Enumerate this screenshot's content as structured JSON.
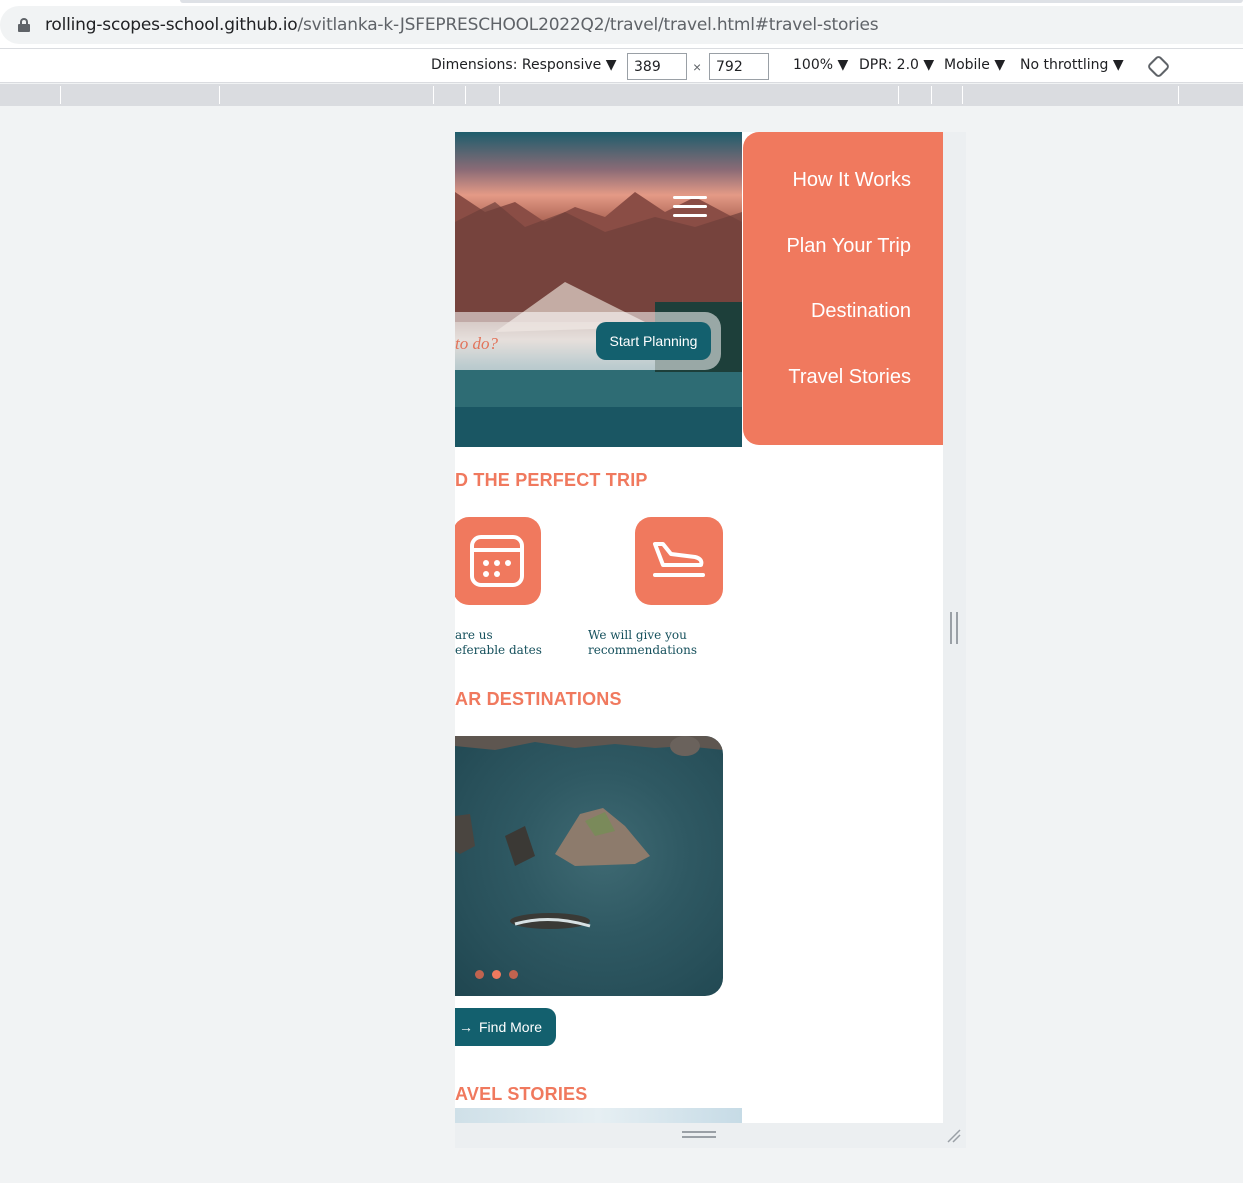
{
  "browser": {
    "url_host": "rolling-scopes-school.github.io",
    "url_path": "/svitlanka-k-JSFEPRESCHOOL2022Q2/travel/travel.html#travel-stories"
  },
  "devtools": {
    "dimensions_label": "Dimensions: Responsive ▼",
    "width_value": "389",
    "height_value": "792",
    "times": "×",
    "zoom_label": "100% ▼",
    "dpr_label": "DPR: 2.0 ▼",
    "device_label": "Mobile ▼",
    "throttling_label": "No throttling ▼",
    "rotate_icon": "rotate-icon"
  },
  "page": {
    "search_placeholder": "to do?",
    "start_button": "Start Planning",
    "menu": [
      "How It Works",
      "Plan Your Trip",
      "Destination",
      "Travel Stories"
    ],
    "section_trip": "D THE PERFECT TRIP",
    "steps": [
      {
        "line1": "are us",
        "line2": "eferable dates",
        "icon": "calendar-icon"
      },
      {
        "line1": "We will give you",
        "line2": "recommendations",
        "icon": "airplane-landing-icon"
      }
    ],
    "section_destinations": "AR DESTINATIONS",
    "find_button": "Find More",
    "find_arrow": "→",
    "section_stories": "AVEL STORIES",
    "slider_dots": 3,
    "active_dot": 2
  },
  "colors": {
    "accent": "#f0795e",
    "primary": "#13606e",
    "text_dark": "#15505c"
  }
}
